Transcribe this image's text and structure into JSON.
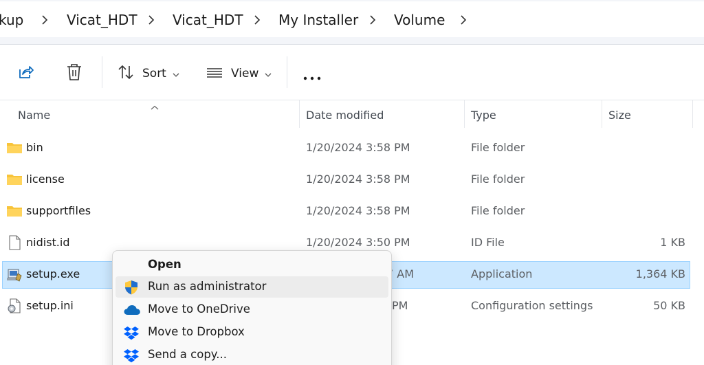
{
  "breadcrumb": {
    "items": [
      "kup",
      "Vicat_HDT",
      "Vicat_HDT",
      "My Installer",
      "Volume"
    ]
  },
  "toolbar": {
    "share_icon": "share-icon",
    "delete_icon": "trash-icon",
    "sort_label": "Sort",
    "view_label": "View",
    "more_icon": "more-horizontal-icon"
  },
  "columns": {
    "name": "Name",
    "date": "Date modified",
    "type": "Type",
    "size": "Size"
  },
  "files": [
    {
      "name": "bin",
      "date": "1/20/2024 3:58 PM",
      "type": "File folder",
      "size": "",
      "icon": "folder-icon"
    },
    {
      "name": "license",
      "date": "1/20/2024 3:58 PM",
      "type": "File folder",
      "size": "",
      "icon": "folder-icon"
    },
    {
      "name": "supportfiles",
      "date": "1/20/2024 3:58 PM",
      "type": "File folder",
      "size": "",
      "icon": "folder-icon"
    },
    {
      "name": "nidist.id",
      "date": "1/20/2024 3:50 PM",
      "type": "ID File",
      "size": "1 KB",
      "icon": "file-icon"
    },
    {
      "name": "setup.exe",
      "date": "7 AM",
      "type": "Application",
      "size": "1,364 KB",
      "icon": "installer-icon",
      "selected": true
    },
    {
      "name": "setup.ini",
      "date": "PM",
      "type": "Configuration settings",
      "size": "50 KB",
      "icon": "settings-file-icon"
    }
  ],
  "context_menu": {
    "items": [
      {
        "label": "Open",
        "icon": "",
        "bold": true
      },
      {
        "label": "Run as administrator",
        "icon": "uac-shield-icon",
        "hover": true
      },
      {
        "label": "Move to OneDrive",
        "icon": "onedrive-icon"
      },
      {
        "label": "Move to Dropbox",
        "icon": "dropbox-icon"
      },
      {
        "label": "Send a copy...",
        "icon": "dropbox-icon"
      }
    ]
  },
  "colors": {
    "selection": "#cce8ff",
    "selection_border": "#99d1ff",
    "folder": "#f8c43a",
    "onedrive": "#0f6cbd",
    "dropbox": "#0061fe"
  }
}
